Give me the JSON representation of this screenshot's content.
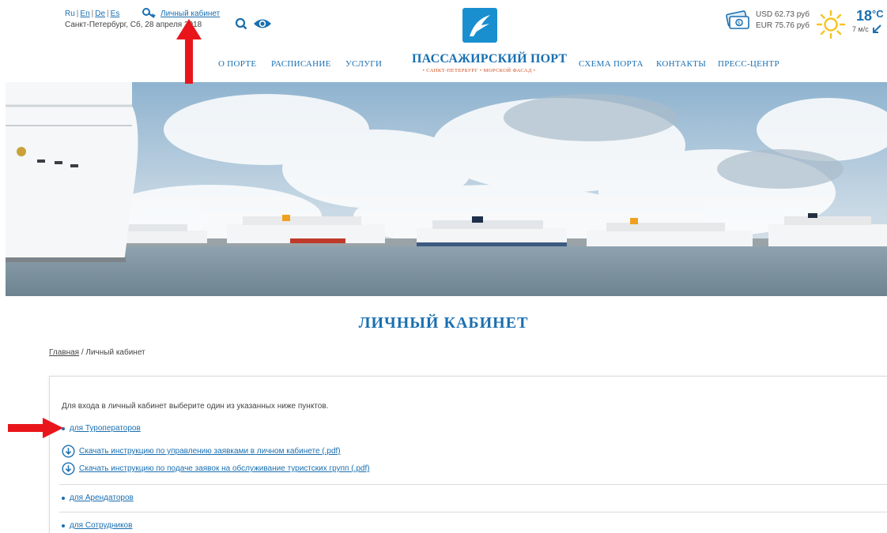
{
  "header": {
    "langs": {
      "ru": "Ru",
      "en": "En",
      "de": "De",
      "es": "Es",
      "sep": "|"
    },
    "dateline": "Санкт-Петербург,  Сб, 28 апреля 2018",
    "account_link": "Личный кабинет",
    "currency": {
      "usd": "USD 62.73 руб",
      "eur": "EUR 75.76 руб"
    },
    "weather": {
      "temp": "18",
      "unit": "°C",
      "wind": "7 м/с"
    },
    "brand": {
      "main": "ПАССАЖИРСКИЙ ПОРТ",
      "sub": "• САНКТ-ПЕТЕРБУРГ • МОРСКОЙ ФАСАД •"
    },
    "nav": {
      "about": "О порте",
      "schedule": "Расписание",
      "services": "Услуги",
      "map": "Схема порта",
      "contacts": "Контакты",
      "press": "Пресс-центр"
    }
  },
  "main": {
    "title": "Личный кабинет",
    "breadcrumb": {
      "home": "Главная",
      "sep": "/",
      "current": "Личный кабинет"
    },
    "intro": "Для входа в личный кабинет выберите один из указанных ниже пунктов.",
    "groups": [
      {
        "label": "для Туроператоров"
      },
      {
        "label": "для Арендаторов"
      },
      {
        "label": "для Сотрудников"
      }
    ],
    "downloads": [
      {
        "label": "Скачать инструкцию по управлению заявками в личном кабинете (.pdf)"
      },
      {
        "label": "Скачать инструкцию по подаче заявок на обслуживание туристских групп (.pdf)"
      }
    ]
  },
  "colors": {
    "brand_blue": "#1a6fb0",
    "accent_orange": "#d04a1b",
    "annotation_red": "#e8161b",
    "sun": "#f6c31f"
  },
  "icons": [
    "key-icon",
    "search-icon",
    "eye-icon",
    "logo-icon",
    "money-icon",
    "sun-icon",
    "wind-arrow-icon",
    "download-icon"
  ]
}
